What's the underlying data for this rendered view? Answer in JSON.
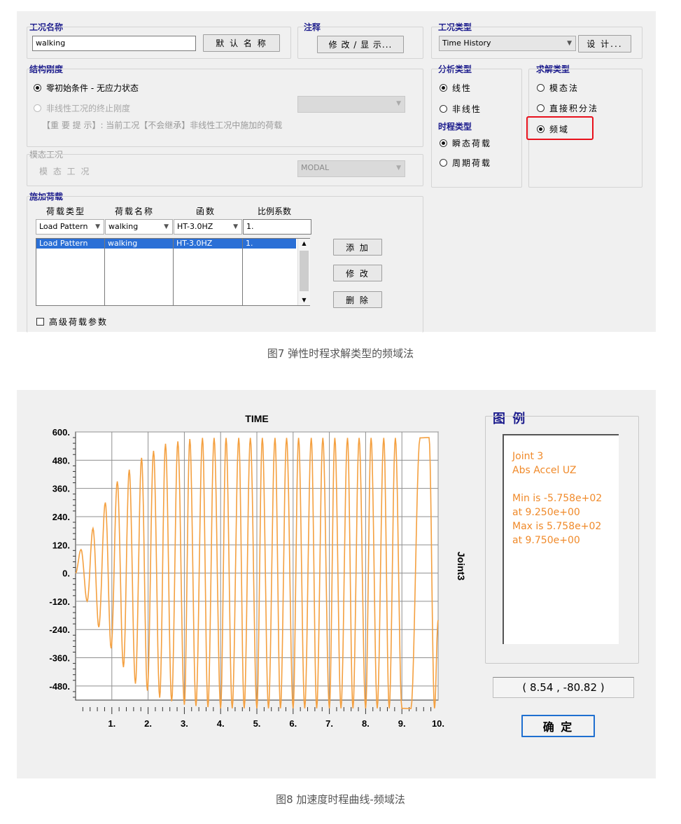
{
  "dialog1": {
    "case_name": {
      "label": "工况名称",
      "value": "walking",
      "default_button": "默 认 名 称"
    },
    "note": {
      "label": "注释",
      "button": "修 改 / 显 示..."
    },
    "case_type": {
      "label": "工况类型",
      "value": "Time History",
      "design_button": "设 计..."
    },
    "stiffness": {
      "label": "结构刚度",
      "option_zero": "零初始条件 - 无应力状态",
      "option_nonlinear": "非线性工况的终止刚度",
      "nonlinear_combo": "",
      "hint": "【重 要 提 示】:  当前工况【不会继承】非线性工况中施加的荷载"
    },
    "modal": {
      "label": "模态工况",
      "field_label": "模 态 工 况",
      "value": "MODAL"
    },
    "analysis_type": {
      "label": "分析类型",
      "linear": "线性",
      "nonlinear": "非线性"
    },
    "history_type": {
      "label": "时程类型",
      "transient": "瞬态荷载",
      "periodic": "周期荷载"
    },
    "solution_type": {
      "label": "求解类型",
      "modal": "模态法",
      "direct": "直接积分法",
      "frequency": "频域"
    },
    "highlight_color": "#e8111c",
    "loads": {
      "label": "施加荷载",
      "headers": [
        "荷载类型",
        "荷载名称",
        "函数",
        "比例系数"
      ],
      "edit_row": [
        "Load Pattern",
        "walking",
        "HT-3.0HZ",
        "1."
      ],
      "rows": [
        [
          "Load Pattern",
          "walking",
          "HT-3.0HZ",
          "1."
        ]
      ],
      "add_button": "添 加",
      "modify_button": "修 改",
      "delete_button": "删 除",
      "advanced": "高级荷载参数"
    }
  },
  "caption1": "图7 弹性时程求解类型的频域法",
  "dialog2": {
    "legend": {
      "title": "图 例",
      "line1": "Joint 3",
      "line2": "Abs Accel  UZ",
      "line3": "Min is -5.758e+02",
      "line4": "at 9.250e+00",
      "line5": "Max is 5.758e+02",
      "line6": "at 9.750e+00"
    },
    "coord_readout": "( 8.54 , -80.82 )",
    "ok_button": "确 定"
  },
  "caption2": "图8 加速度时程曲线-频域法",
  "chart_data": {
    "type": "line",
    "title": "TIME",
    "xlabel": "",
    "ylabel": "Joint3",
    "xlim": [
      0,
      10
    ],
    "ylim": [
      -540,
      600
    ],
    "x_ticks": [
      "1.",
      "2.",
      "3.",
      "4.",
      "5.",
      "6.",
      "7.",
      "8.",
      "9.",
      "10."
    ],
    "y_ticks": [
      "600.",
      "480.",
      "360.",
      "240.",
      "120.",
      "0.",
      "-120.",
      "-240.",
      "-360.",
      "-480."
    ],
    "series": [
      {
        "color": "#f4a040",
        "description_of_signal": "ramped sinusoid approx 3 Hz",
        "peaks": [
          {
            "x": 0.15,
            "y": 100
          },
          {
            "x": 0.32,
            "y": -120
          },
          {
            "x": 0.48,
            "y": 190
          },
          {
            "x": 0.64,
            "y": -230
          },
          {
            "x": 0.82,
            "y": 300
          },
          {
            "x": 0.98,
            "y": -320
          },
          {
            "x": 1.15,
            "y": 390
          },
          {
            "x": 1.32,
            "y": -400
          },
          {
            "x": 1.48,
            "y": 440
          },
          {
            "x": 1.65,
            "y": -470
          },
          {
            "x": 1.82,
            "y": 490
          },
          {
            "x": 1.98,
            "y": -500
          },
          {
            "x": 2.15,
            "y": 520
          },
          {
            "x": 2.32,
            "y": -530
          },
          {
            "x": 2.48,
            "y": 550
          },
          {
            "x": 2.65,
            "y": -545
          },
          {
            "x": 2.82,
            "y": 560
          },
          {
            "x": 3.0,
            "y": -560
          },
          {
            "x": 3.15,
            "y": 570
          },
          {
            "x": 3.32,
            "y": -565
          },
          {
            "x": 3.5,
            "y": 575
          },
          {
            "x": 3.65,
            "y": -570
          },
          {
            "x": 3.82,
            "y": 575
          },
          {
            "x": 4.0,
            "y": -575
          },
          {
            "x": 4.15,
            "y": 575
          },
          {
            "x": 4.32,
            "y": -575
          },
          {
            "x": 4.5,
            "y": 575
          },
          {
            "x": 4.65,
            "y": -575
          },
          {
            "x": 4.82,
            "y": 575
          },
          {
            "x": 5.0,
            "y": -575
          },
          {
            "x": 5.15,
            "y": 575
          },
          {
            "x": 5.32,
            "y": -575
          },
          {
            "x": 5.5,
            "y": 575
          },
          {
            "x": 5.65,
            "y": -575
          },
          {
            "x": 5.82,
            "y": 575
          },
          {
            "x": 6.0,
            "y": -575
          },
          {
            "x": 6.15,
            "y": 575
          },
          {
            "x": 6.32,
            "y": -575
          },
          {
            "x": 6.5,
            "y": 575
          },
          {
            "x": 6.65,
            "y": -575
          },
          {
            "x": 6.82,
            "y": 575
          },
          {
            "x": 7.0,
            "y": -575
          },
          {
            "x": 7.15,
            "y": 575
          },
          {
            "x": 7.32,
            "y": -575
          },
          {
            "x": 7.5,
            "y": 575
          },
          {
            "x": 7.65,
            "y": -575
          },
          {
            "x": 7.82,
            "y": 575
          },
          {
            "x": 8.0,
            "y": -575
          },
          {
            "x": 8.15,
            "y": 575
          },
          {
            "x": 8.32,
            "y": -575
          },
          {
            "x": 8.5,
            "y": 575
          },
          {
            "x": 8.65,
            "y": -575
          },
          {
            "x": 8.82,
            "y": 575
          },
          {
            "x": 9.0,
            "y": -575
          },
          {
            "x": 9.25,
            "y": -576
          },
          {
            "x": 9.5,
            "y": 575
          },
          {
            "x": 9.75,
            "y": 576
          },
          {
            "x": 9.9,
            "y": -575
          }
        ]
      }
    ],
    "grid": true
  }
}
